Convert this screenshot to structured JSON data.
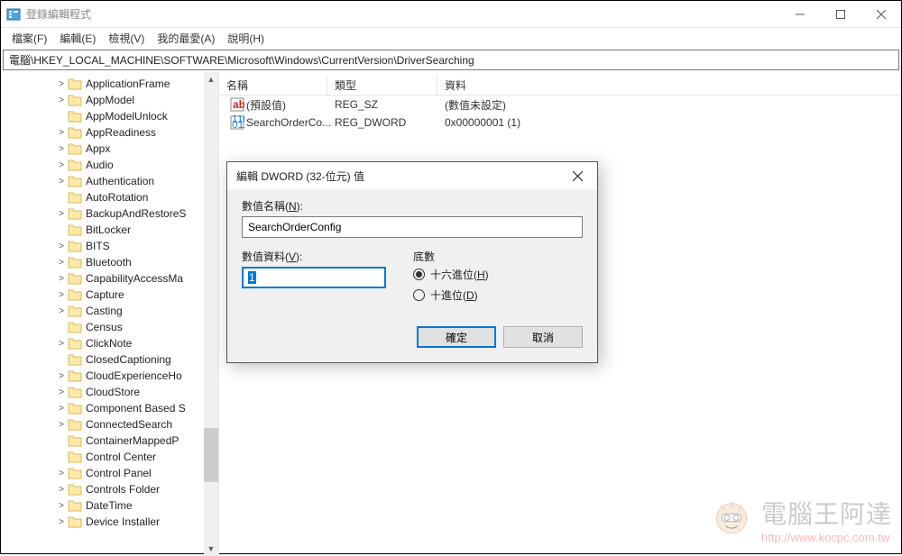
{
  "app": {
    "title": "登錄編輯程式"
  },
  "menubar": {
    "file": "檔案(F)",
    "edit": "編輯(E)",
    "view": "檢視(V)",
    "favorites": "我的最愛(A)",
    "help": "說明(H)"
  },
  "address": "電腦\\HKEY_LOCAL_MACHINE\\SOFTWARE\\Microsoft\\Windows\\CurrentVersion\\DriverSearching",
  "tree": [
    {
      "label": "ApplicationFrame",
      "expander": ">"
    },
    {
      "label": "AppModel",
      "expander": ">"
    },
    {
      "label": "AppModelUnlock",
      "expander": ""
    },
    {
      "label": "AppReadiness",
      "expander": ">"
    },
    {
      "label": "Appx",
      "expander": ">"
    },
    {
      "label": "Audio",
      "expander": ">"
    },
    {
      "label": "Authentication",
      "expander": ">"
    },
    {
      "label": "AutoRotation",
      "expander": ""
    },
    {
      "label": "BackupAndRestoreS",
      "expander": ">"
    },
    {
      "label": "BitLocker",
      "expander": ""
    },
    {
      "label": "BITS",
      "expander": ">"
    },
    {
      "label": "Bluetooth",
      "expander": ">"
    },
    {
      "label": "CapabilityAccessMa",
      "expander": ">"
    },
    {
      "label": "Capture",
      "expander": ">"
    },
    {
      "label": "Casting",
      "expander": ">"
    },
    {
      "label": "Census",
      "expander": ""
    },
    {
      "label": "ClickNote",
      "expander": ">"
    },
    {
      "label": "ClosedCaptioning",
      "expander": ""
    },
    {
      "label": "CloudExperienceHo",
      "expander": ">"
    },
    {
      "label": "CloudStore",
      "expander": ">"
    },
    {
      "label": "Component Based S",
      "expander": ">"
    },
    {
      "label": "ConnectedSearch",
      "expander": ">"
    },
    {
      "label": "ContainerMappedP",
      "expander": ""
    },
    {
      "label": "Control Center",
      "expander": ""
    },
    {
      "label": "Control Panel",
      "expander": ">"
    },
    {
      "label": "Controls Folder",
      "expander": ">"
    },
    {
      "label": "DateTime",
      "expander": ">"
    },
    {
      "label": "Device Installer",
      "expander": ">"
    }
  ],
  "list": {
    "headers": {
      "name": "名稱",
      "type": "類型",
      "data": "資料"
    },
    "rows": [
      {
        "icon": "sz",
        "name": "(預設值)",
        "type": "REG_SZ",
        "data": "(數值未設定)"
      },
      {
        "icon": "dw",
        "name": "SearchOrderCo...",
        "type": "REG_DWORD",
        "data": "0x00000001 (1)"
      }
    ]
  },
  "dialog": {
    "title": "編輯 DWORD (32-位元) 值",
    "name_label": "數值名稱(N):",
    "name_value": "SearchOrderConfig",
    "data_label": "數值資料(V):",
    "data_value": "1",
    "base_label": "底數",
    "radio_hex": "十六進位(H)",
    "radio_dec": "十進位(D)",
    "ok": "確定",
    "cancel": "取消"
  },
  "watermark": {
    "text": "電腦王阿達",
    "url": "http://www.kocpc.com.tw"
  }
}
